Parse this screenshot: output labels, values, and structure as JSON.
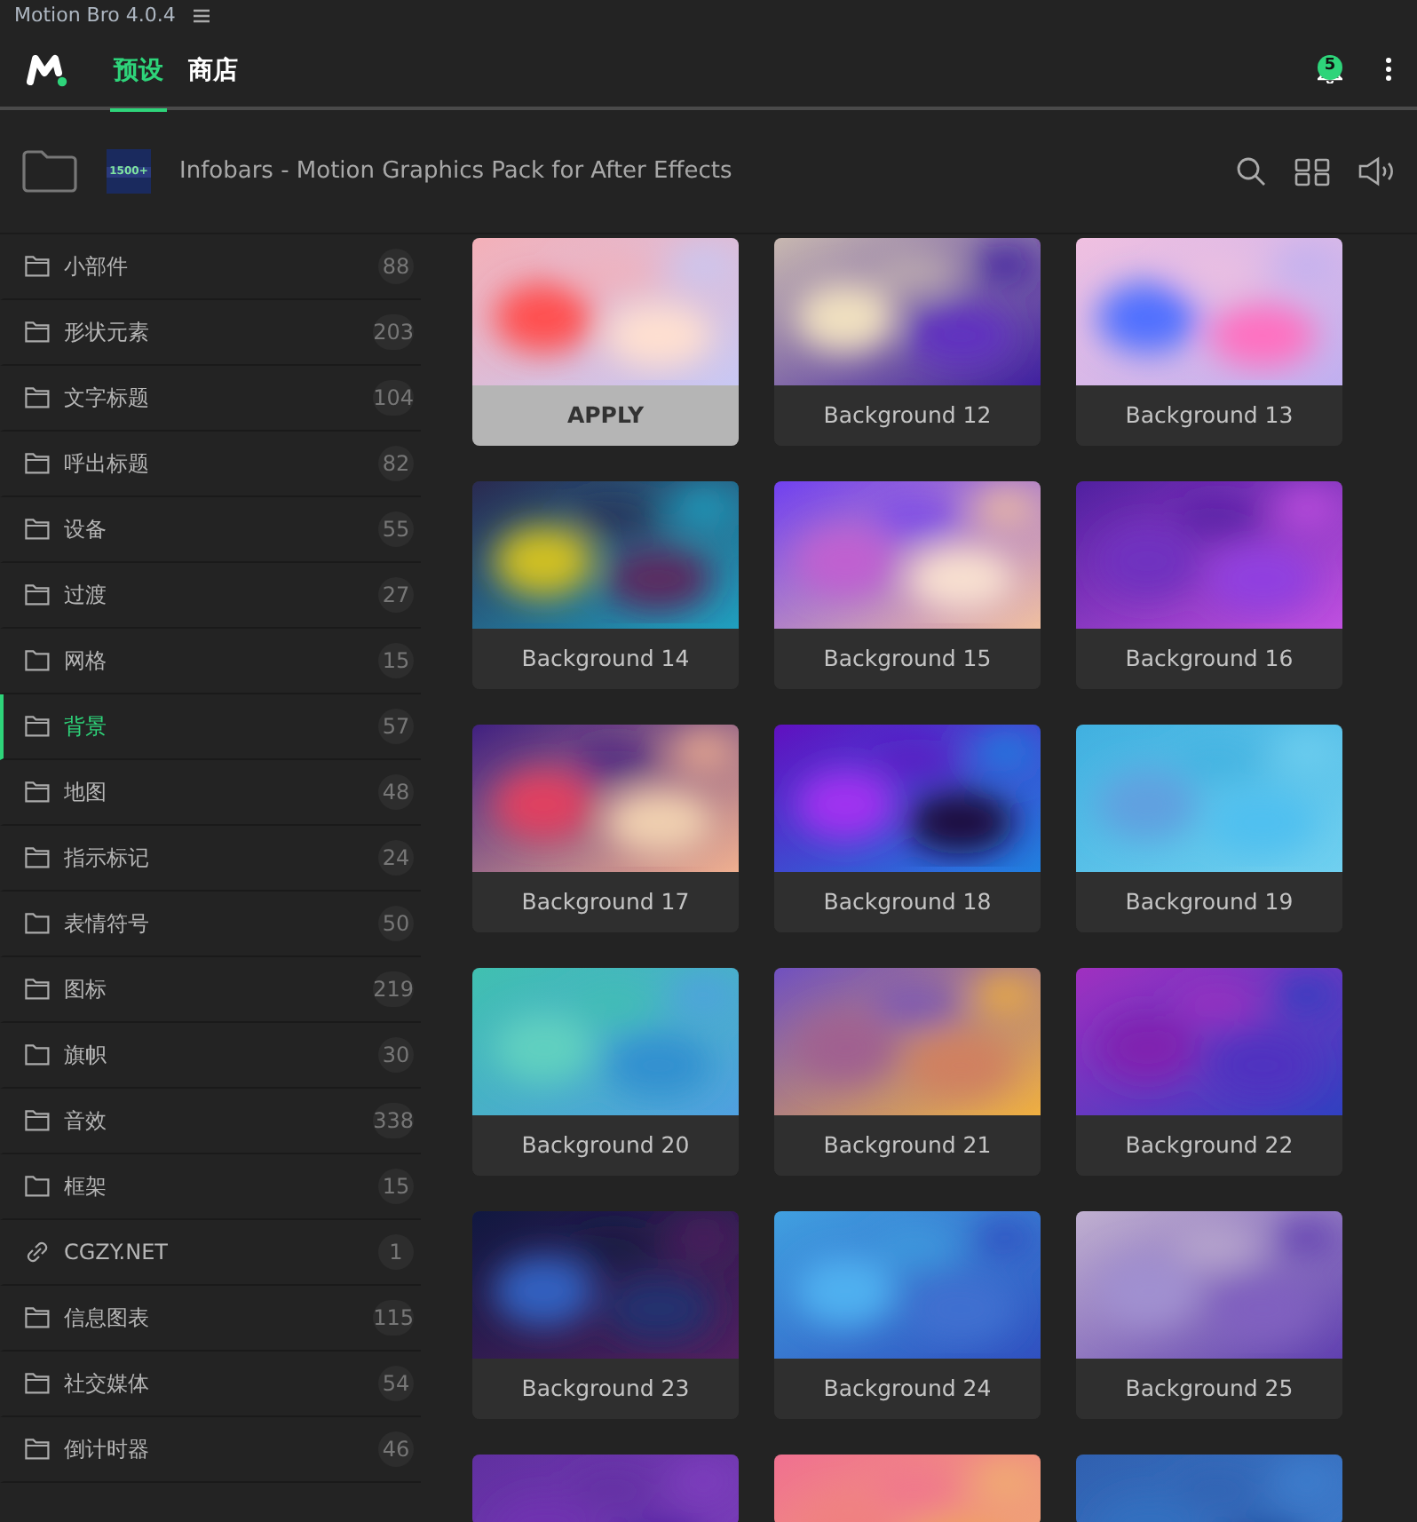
{
  "window": {
    "title": "Motion Bro 4.0.4"
  },
  "tabs": [
    {
      "label": "预设",
      "selected": true
    },
    {
      "label": "商店",
      "selected": false
    }
  ],
  "notifications": {
    "count": "5"
  },
  "pack": {
    "title": "Infobars - Motion Graphics Pack for After Effects",
    "thumbnail_text": "1500+"
  },
  "sidebar": {
    "items": [
      {
        "kind": "folder-tabbed",
        "label": "小部件",
        "count": "88",
        "selected": false
      },
      {
        "kind": "folder-tabbed",
        "label": "形状元素",
        "count": "203",
        "selected": false
      },
      {
        "kind": "folder-tabbed",
        "label": "文字标题",
        "count": "104",
        "selected": false
      },
      {
        "kind": "folder-tabbed",
        "label": "呼出标题",
        "count": "82",
        "selected": false
      },
      {
        "kind": "folder-tabbed",
        "label": "设备",
        "count": "55",
        "selected": false
      },
      {
        "kind": "folder-tabbed",
        "label": "过渡",
        "count": "27",
        "selected": false
      },
      {
        "kind": "folder",
        "label": "网格",
        "count": "15",
        "selected": false
      },
      {
        "kind": "folder-tabbed",
        "label": "背景",
        "count": "57",
        "selected": true
      },
      {
        "kind": "folder-tabbed",
        "label": "地图",
        "count": "48",
        "selected": false
      },
      {
        "kind": "folder-tabbed",
        "label": "指示标记",
        "count": "24",
        "selected": false
      },
      {
        "kind": "folder",
        "label": "表情符号",
        "count": "50",
        "selected": false
      },
      {
        "kind": "folder-tabbed",
        "label": "图标",
        "count": "219",
        "selected": false
      },
      {
        "kind": "folder",
        "label": "旗帜",
        "count": "30",
        "selected": false
      },
      {
        "kind": "folder-tabbed",
        "label": "音效",
        "count": "338",
        "selected": false
      },
      {
        "kind": "folder",
        "label": "框架",
        "count": "15",
        "selected": false
      },
      {
        "kind": "link",
        "label": "CGZY.NET",
        "count": "1",
        "selected": false
      },
      {
        "kind": "folder-tabbed",
        "label": "信息图表",
        "count": "115",
        "selected": false
      },
      {
        "kind": "folder-tabbed",
        "label": "社交媒体",
        "count": "54",
        "selected": false
      },
      {
        "kind": "folder-tabbed",
        "label": "倒计时器",
        "count": "46",
        "selected": false
      }
    ]
  },
  "presets": [
    {
      "label": "APPLY",
      "hovered": true
    },
    {
      "label": "Background 12",
      "hovered": false
    },
    {
      "label": "Background 13",
      "hovered": false
    },
    {
      "label": "Background 14",
      "hovered": false
    },
    {
      "label": "Background 15",
      "hovered": false
    },
    {
      "label": "Background 16",
      "hovered": false
    },
    {
      "label": "Background 17",
      "hovered": false
    },
    {
      "label": "Background 18",
      "hovered": false
    },
    {
      "label": "Background 19",
      "hovered": false
    },
    {
      "label": "Background 20",
      "hovered": false
    },
    {
      "label": "Background 21",
      "hovered": false
    },
    {
      "label": "Background 22",
      "hovered": false
    },
    {
      "label": "Background 23",
      "hovered": false
    },
    {
      "label": "Background 24",
      "hovered": false
    },
    {
      "label": "Background 25",
      "hovered": false
    },
    {
      "kind": "picture"
    },
    {
      "kind": "picture"
    },
    {
      "kind": "picture"
    }
  ]
}
